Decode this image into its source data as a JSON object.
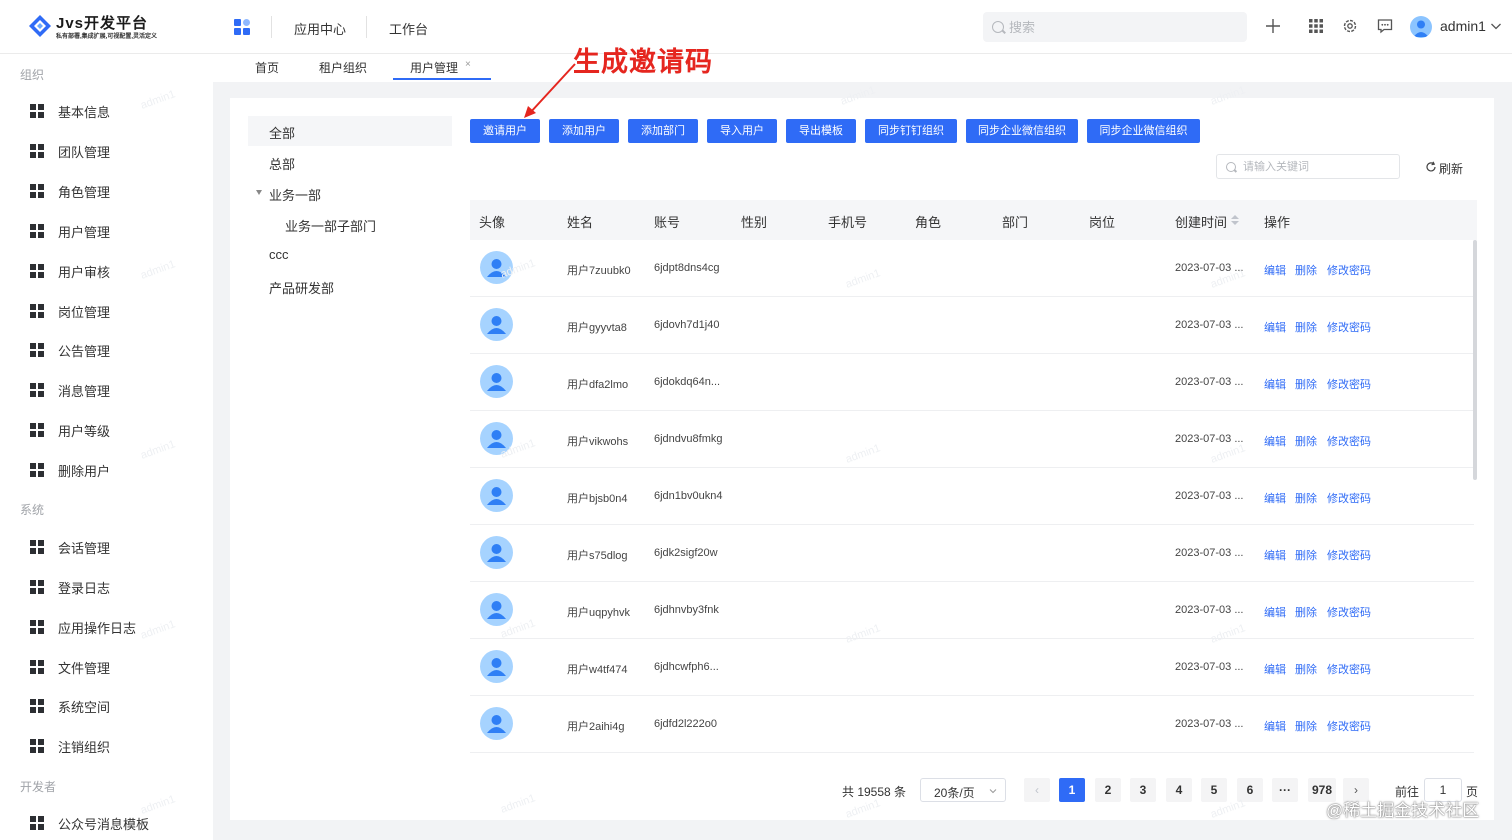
{
  "header": {
    "logo_title": "Jvs开发平台",
    "logo_subtitle": "私有部署,集成扩展,可视配置,灵活定义",
    "nav": [
      "应用中心",
      "工作台"
    ],
    "search_placeholder": "搜索",
    "user_name": "admin1"
  },
  "sidebar": {
    "sections": [
      {
        "title": "组织",
        "items": [
          "基本信息",
          "团队管理",
          "角色管理",
          "用户管理",
          "用户审核",
          "岗位管理",
          "公告管理",
          "消息管理",
          "用户等级",
          "删除用户"
        ]
      },
      {
        "title": "系统",
        "items": [
          "会话管理",
          "登录日志",
          "应用操作日志",
          "文件管理",
          "系统空间",
          "注销组织"
        ]
      },
      {
        "title": "开发者",
        "items": [
          "公众号消息模板"
        ]
      }
    ]
  },
  "tabs": [
    {
      "label": "首页",
      "active": false
    },
    {
      "label": "租户组织",
      "active": false
    },
    {
      "label": "用户管理",
      "active": true
    }
  ],
  "tree": {
    "items": [
      {
        "label": "全部",
        "selected": true
      },
      {
        "label": "总部"
      },
      {
        "label": "业务一部",
        "expanded": true
      },
      {
        "label": "业务一部子部门"
      },
      {
        "label": "ccc"
      },
      {
        "label": "产品研发部"
      }
    ]
  },
  "toolbar": {
    "buttons": [
      "邀请用户",
      "添加用户",
      "添加部门",
      "导入用户",
      "导出模板",
      "同步钉钉组织",
      "同步企业微信组织",
      "同步企业微信组织"
    ],
    "keyword_placeholder": "请输入关键词",
    "refresh_label": "刷新"
  },
  "table": {
    "columns": [
      "头像",
      "姓名",
      "账号",
      "性别",
      "手机号",
      "角色",
      "部门",
      "岗位",
      "创建时间",
      "操作"
    ],
    "rows": [
      {
        "name": "用户7zuubk0",
        "account": "6jdpt8dns4cg",
        "created": "2023-07-03 ..."
      },
      {
        "name": "用户gyyvta8",
        "account": "6jdovh7d1j40",
        "created": "2023-07-03 ..."
      },
      {
        "name": "用户dfa2lmo",
        "account": "6jdokdq64n...",
        "created": "2023-07-03 ..."
      },
      {
        "name": "用户vikwohs",
        "account": "6jdndvu8fmkg",
        "created": "2023-07-03 ..."
      },
      {
        "name": "用户bjsb0n4",
        "account": "6jdn1bv0ukn4",
        "created": "2023-07-03 ..."
      },
      {
        "name": "用户s75dlog",
        "account": "6jdk2sigf20w",
        "created": "2023-07-03 ..."
      },
      {
        "name": "用户uqpyhvk",
        "account": "6jdhnvby3fnk",
        "created": "2023-07-03 ..."
      },
      {
        "name": "用户w4tf474",
        "account": "6jdhcwfph6...",
        "created": "2023-07-03 ..."
      },
      {
        "name": "用户2aihi4g",
        "account": "6jdfd2l222o0",
        "created": "2023-07-03 ..."
      }
    ],
    "actions": [
      "编辑",
      "删除",
      "修改密码"
    ]
  },
  "pagination": {
    "total_label": "共 19558 条",
    "page_size": "20条/页",
    "pages": [
      "1",
      "2",
      "3",
      "4",
      "5",
      "6",
      "···",
      "978"
    ],
    "current_page": "1",
    "goto_prefix": "前往",
    "goto_value": "1",
    "goto_suffix": "页"
  },
  "annotation": {
    "text": "生成邀请码",
    "color": "#e5261f"
  },
  "watermark": {
    "text": "admin1",
    "corner": "@稀土掘金技术社区"
  },
  "colors": {
    "primary": "#2f6bf6",
    "avatar": "#a6d3ff"
  }
}
